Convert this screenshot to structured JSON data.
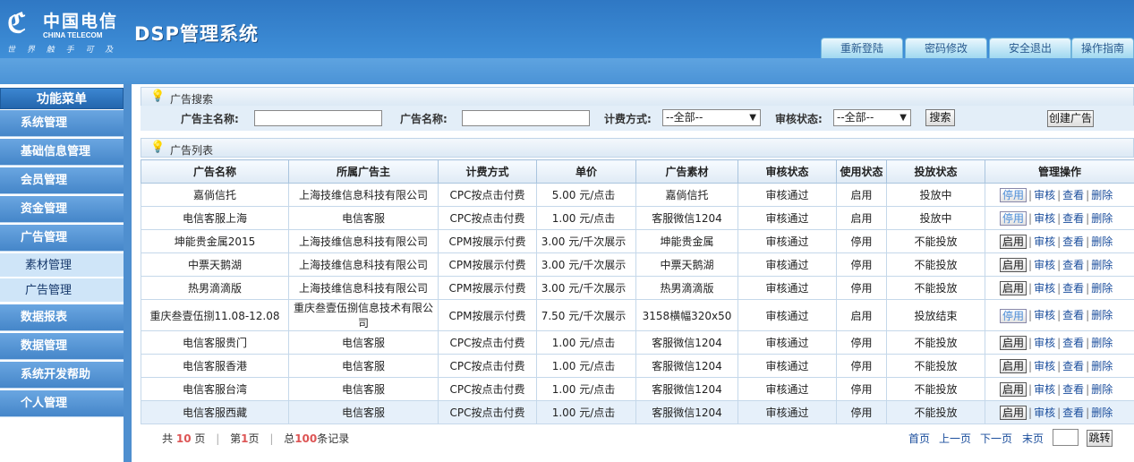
{
  "brand": {
    "logo_cn": "中国电信",
    "logo_en": "CHINA TELECOM",
    "slogan": "世 界 触 手 可 及",
    "system_title": "DSP管理系统"
  },
  "top_tabs": [
    "重新登陆",
    "密码修改",
    "安全退出",
    "操作指南"
  ],
  "sidebar": {
    "title": "功能菜单",
    "items": [
      {
        "label": "系统管理"
      },
      {
        "label": "基础信息管理"
      },
      {
        "label": "会员管理"
      },
      {
        "label": "资金管理"
      },
      {
        "label": "广告管理"
      },
      {
        "label": "素材管理",
        "sub": true
      },
      {
        "label": "广告管理",
        "sub": true
      },
      {
        "label": "数据报表"
      },
      {
        "label": "数据管理"
      },
      {
        "label": "系统开发帮助"
      },
      {
        "label": "个人管理"
      }
    ]
  },
  "search": {
    "title": "广告搜索",
    "advertiser_label": "广告主名称:",
    "ad_name_label": "广告名称:",
    "billing_label": "计费方式:",
    "billing_value": "--全部--",
    "review_label": "审核状态:",
    "review_value": "--全部--",
    "search_button": "搜索",
    "create_button": "创建广告"
  },
  "list": {
    "title": "广告列表",
    "columns": [
      "广告名称",
      "所属广告主",
      "计费方式",
      "单价",
      "广告素材",
      "审核状态",
      "使用状态",
      "投放状态",
      "管理操作"
    ],
    "rows": [
      {
        "name": "嘉倘信托",
        "owner": "上海技维信息科技有限公司",
        "billing": "CPC按点击付费",
        "price": "5.00 元/点击",
        "creative": "嘉倘信托",
        "review": "审核通过",
        "use": "启用",
        "use_muted": false,
        "deliver": "投放中",
        "deliver_style": "normal",
        "toggle": "停用",
        "toggle_blue": true
      },
      {
        "name": "电信客服上海",
        "owner": "电信客服",
        "billing": "CPC按点击付费",
        "price": "1.00 元/点击",
        "creative": "客服微信1204",
        "review": "审核通过",
        "use": "启用",
        "use_muted": false,
        "deliver": "投放中",
        "deliver_style": "normal",
        "toggle": "停用",
        "toggle_blue": true
      },
      {
        "name": "坤能贵金属2015",
        "owner": "上海技维信息科技有限公司",
        "billing": "CPM按展示付费",
        "price": "3.00 元/千次展示",
        "creative": "坤能贵金属",
        "review": "审核通过",
        "use": "停用",
        "use_muted": true,
        "deliver": "不能投放",
        "deliver_style": "muted",
        "toggle": "启用",
        "toggle_blue": false
      },
      {
        "name": "中票天鹅湖",
        "owner": "上海技维信息科技有限公司",
        "billing": "CPM按展示付费",
        "price": "3.00 元/千次展示",
        "creative": "中票天鹅湖",
        "review": "审核通过",
        "use": "停用",
        "use_muted": true,
        "deliver": "不能投放",
        "deliver_style": "muted",
        "toggle": "启用",
        "toggle_blue": false
      },
      {
        "name": "热男滴滴版",
        "owner": "上海技维信息科技有限公司",
        "billing": "CPM按展示付费",
        "price": "3.00 元/千次展示",
        "creative": "热男滴滴版",
        "review": "审核通过",
        "use": "停用",
        "use_muted": true,
        "deliver": "不能投放",
        "deliver_style": "muted",
        "toggle": "启用",
        "toggle_blue": false
      },
      {
        "name": "重庆叁壹伍捌11.08-12.08",
        "owner": "重庆叁壹伍捌信息技术有限公司",
        "billing": "CPM按展示付费",
        "price": "7.50 元/千次展示",
        "creative": "3158横幅320x50",
        "review": "审核通过",
        "use": "启用",
        "use_muted": false,
        "deliver": "投放结束",
        "deliver_style": "red",
        "toggle": "停用",
        "toggle_blue": true,
        "tall": true
      },
      {
        "name": "电信客服贵门",
        "owner": "电信客服",
        "billing": "CPC按点击付费",
        "price": "1.00 元/点击",
        "creative": "客服微信1204",
        "review": "审核通过",
        "use": "停用",
        "use_muted": true,
        "deliver": "不能投放",
        "deliver_style": "muted",
        "toggle": "启用",
        "toggle_blue": false
      },
      {
        "name": "电信客服香港",
        "owner": "电信客服",
        "billing": "CPC按点击付费",
        "price": "1.00 元/点击",
        "creative": "客服微信1204",
        "review": "审核通过",
        "use": "停用",
        "use_muted": true,
        "deliver": "不能投放",
        "deliver_style": "muted",
        "toggle": "启用",
        "toggle_blue": false
      },
      {
        "name": "电信客服台湾",
        "owner": "电信客服",
        "billing": "CPC按点击付费",
        "price": "1.00 元/点击",
        "creative": "客服微信1204",
        "review": "审核通过",
        "use": "停用",
        "use_muted": true,
        "deliver": "不能投放",
        "deliver_style": "muted",
        "toggle": "启用",
        "toggle_blue": false
      },
      {
        "name": "电信客服西藏",
        "owner": "电信客服",
        "billing": "CPC按点击付费",
        "price": "1.00 元/点击",
        "creative": "客服微信1204",
        "review": "审核通过",
        "use": "停用",
        "use_muted": true,
        "deliver": "不能投放",
        "deliver_style": "muted",
        "toggle": "启用",
        "toggle_blue": false,
        "highlight": true
      }
    ],
    "op_review": "审核",
    "op_view": "查看",
    "op_delete": "删除"
  },
  "pager": {
    "total_prefix": "共",
    "total_pages": "10",
    "total_suffix": "页",
    "current_prefix": "第",
    "current_page": "1",
    "current_suffix": "页",
    "records_prefix": "总",
    "records": "100",
    "records_suffix": "条记录",
    "first": "首页",
    "prev": "上一页",
    "next": "下一页",
    "last": "末页",
    "jump": "跳转"
  }
}
